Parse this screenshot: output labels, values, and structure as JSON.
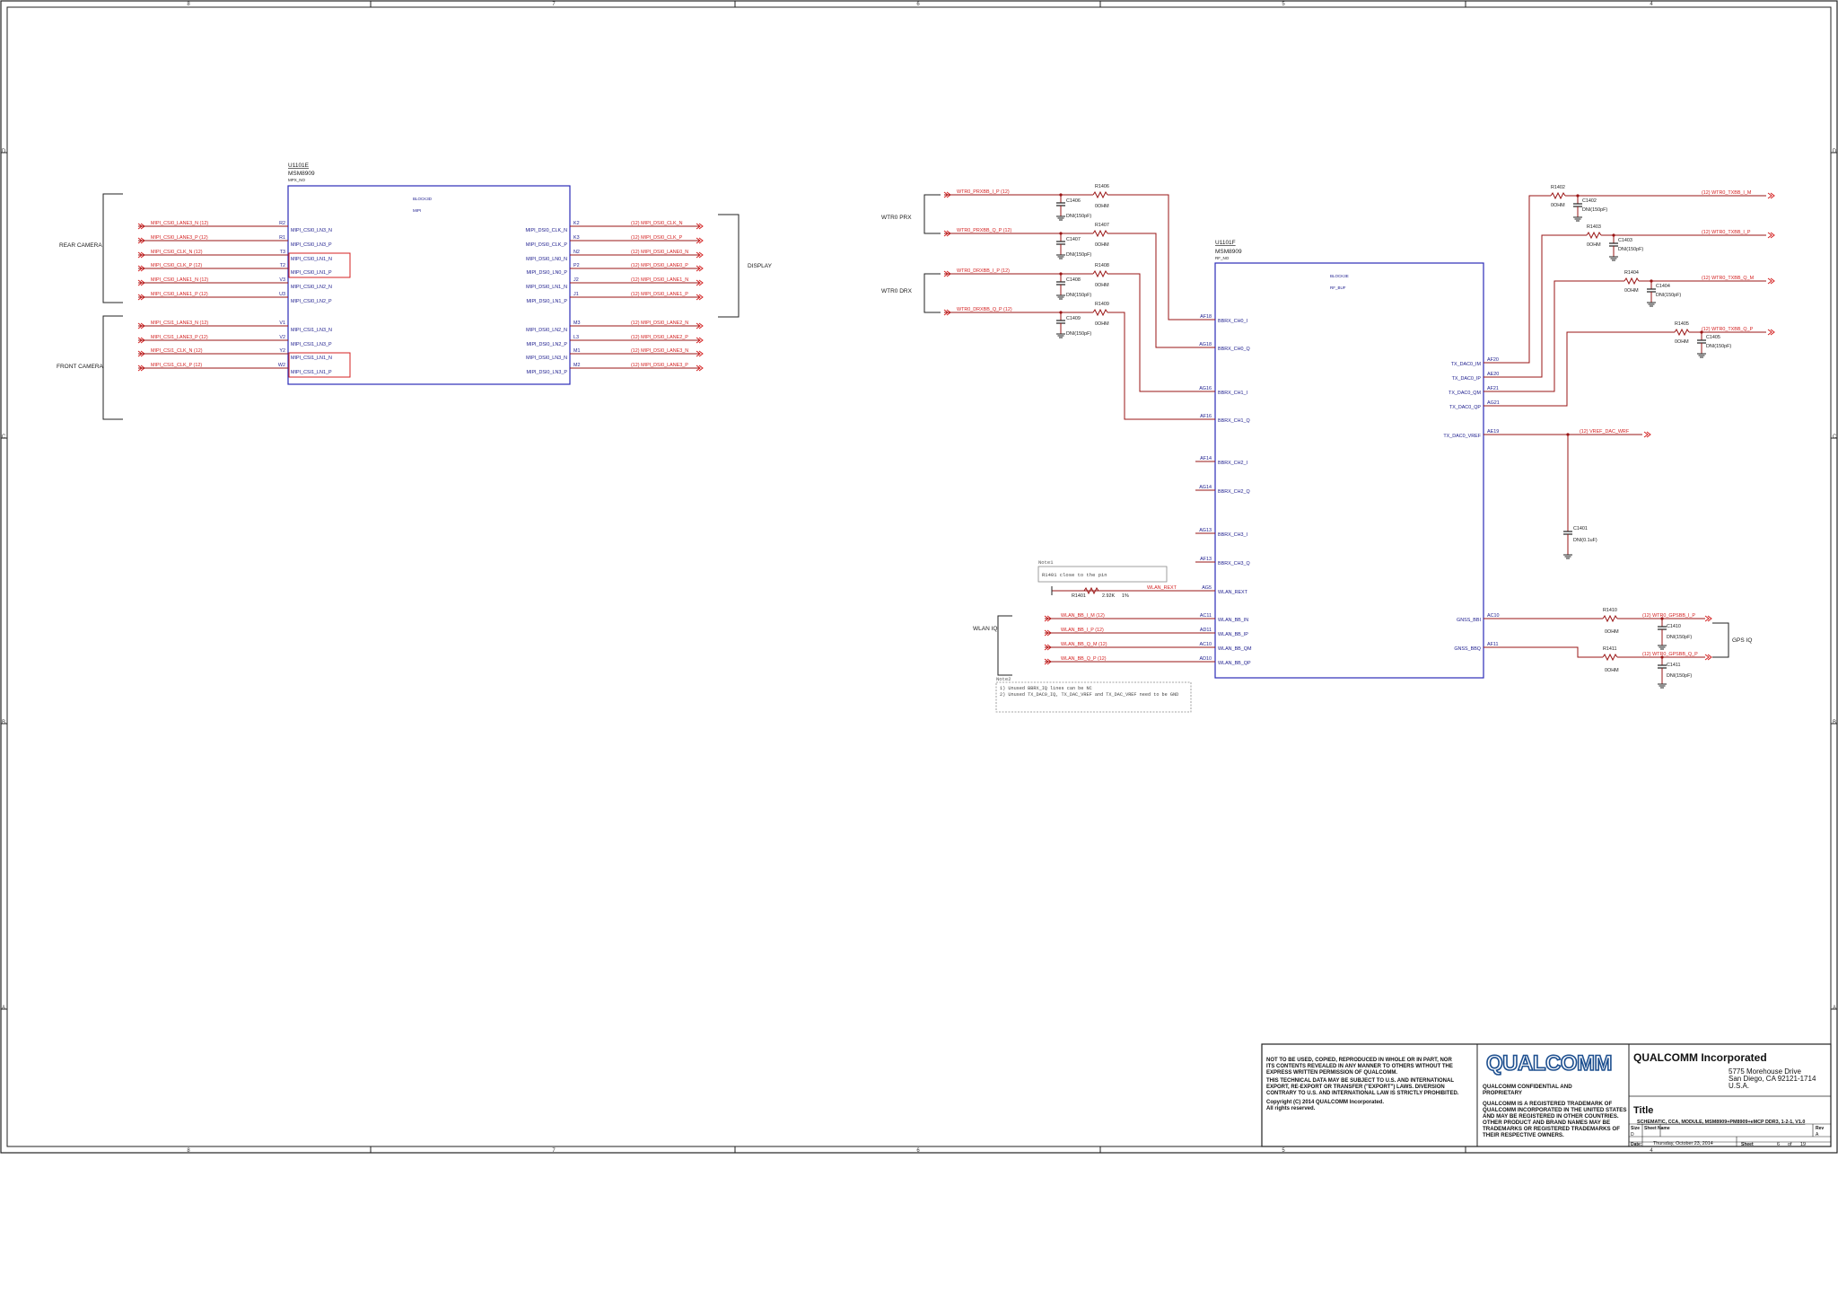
{
  "colors": {
    "frame": "#222222",
    "wire": "#9a1515",
    "net_label": "#d42020",
    "part_outline": "#2b2bb8",
    "pin_text": "#1a1a8c",
    "ref_text": "#1a1a1a",
    "note_border": "#888888",
    "logo": "#1d4f8f"
  },
  "frame": {
    "col_markers": [
      "8",
      "7",
      "6",
      "5",
      "4",
      "3",
      "2",
      "1"
    ],
    "row_markers": [
      "D",
      "C",
      "B",
      "A"
    ]
  },
  "mipi": {
    "ref": "U1101E",
    "part": "MSM8909",
    "sub": "MPX_NO",
    "block_title": "BLOCK3D",
    "block_sub": "MIPI",
    "rear_label": "REAR CAMERA",
    "front_label": "FRONT CAMERA",
    "display_label": "DISPLAY",
    "left_nets": [
      "MIPI_CSI0_LANE3_N  (12)",
      "MIPI_CSI0_LANE3_P  (12)",
      "MIPI_CSI0_CLK_N  (12)",
      "MIPI_CSI0_CLK_P  (12)",
      "MIPI_CSI0_LANE1_N  (12)",
      "MIPI_CSI0_LANE1_P  (12)",
      "MIPI_CSI1_LANE3_N  (12)",
      "MIPI_CSI1_LANE3_P  (12)",
      "MIPI_CSI1_CLK_N  (12)",
      "MIPI_CSI1_CLK_P  (12)"
    ],
    "left_pins": [
      "R2",
      "R1",
      "T3",
      "T2",
      "V3",
      "U3",
      "V1",
      "V2",
      "Y2",
      "W2"
    ],
    "left_signals": [
      "MIPI_CSI0_LN3_N",
      "MIPI_CSI0_LN3_P",
      "MIPI_CSI0_LN1_N",
      "MIPI_CSI0_LN1_P",
      "MIPI_CSI0_LN2_N",
      "MIPI_CSI0_LN2_P",
      "MIPI_CSI1_LN3_N",
      "MIPI_CSI1_LN3_P",
      "MIPI_CSI1_LN1_N",
      "MIPI_CSI1_LN1_P"
    ],
    "right_signals": [
      "MIPI_DSI0_CLK_N",
      "MIPI_DSI0_CLK_P",
      "MIPI_DSI0_LN0_N",
      "MIPI_DSI0_LN0_P",
      "MIPI_DSI0_LN1_N",
      "MIPI_DSI0_LN1_P",
      "MIPI_DSI0_LN2_N",
      "MIPI_DSI0_LN2_P",
      "MIPI_DSI0_LN3_N",
      "MIPI_DSI0_LN3_P"
    ],
    "right_pins": [
      "K2",
      "K3",
      "N2",
      "P2",
      "J2",
      "J1",
      "M3",
      "L3",
      "M1",
      "M2"
    ],
    "right_nets": [
      "(12)  MIPI_DSI0_CLK_N",
      "(12)  MIPI_DSI0_CLK_P",
      "(12)  MIPI_DSI0_LANE0_N",
      "(12)  MIPI_DSI0_LANE0_P",
      "(12)  MIPI_DSI0_LANE1_N",
      "(12)  MIPI_DSI0_LANE1_P",
      "(12)  MIPI_DSI0_LANE2_N",
      "(12)  MIPI_DSI0_LANE2_P",
      "(12)  MIPI_DSI0_LANE3_N",
      "(12)  MIPI_DSI0_LANE3_P"
    ]
  },
  "rf": {
    "ref": "U1101F",
    "part": "MSM8909",
    "sub": "RF_NO",
    "block_title": "BLOCK3E",
    "block_sub": "RF_BUF",
    "prx_label": "WTR0 PRX",
    "drx_label": "WTR0 DRX",
    "wlan_label": "WLAN IQ",
    "gps_label": "GPS IQ",
    "rx_nets": [
      "WTR0_PRXBB_I_P  (12)",
      "WTR0_PRXBB_Q_P  (12)",
      "WTR0_DRXBB_I_P  (12)",
      "WTR0_DRXBB_Q_P  (12)"
    ],
    "rx_res": [
      "R1406",
      "R1407",
      "R1408",
      "R1409"
    ],
    "rx_res_val": "0OHM",
    "rx_caps": [
      "C1406",
      "C1407",
      "C1408",
      "C1409"
    ],
    "dnp_150pf": "DNI(150pF)",
    "left_pins": [
      "AF18",
      "AG18",
      "AG16",
      "AF16",
      "AF14",
      "AG14",
      "AG13",
      "AF13",
      "AG5",
      "AC11",
      "AD11",
      "AC10",
      "AD10"
    ],
    "left_signals": [
      "BBRX_CH0_I",
      "BBRX_CH0_Q",
      "BBRX_CH1_I",
      "BBRX_CH1_Q",
      "BBRX_CH2_I",
      "BBRX_CH2_Q",
      "BBRX_CH3_I",
      "BBRX_CH3_Q",
      "WLAN_REXT",
      "WLAN_BB_IN",
      "WLAN_BB_IP",
      "WLAN_BB_QM",
      "WLAN_BB_QP"
    ],
    "right_signals": [
      "TX_DAC0_IM",
      "TX_DAC0_IP",
      "TX_DAC0_QM",
      "TX_DAC0_QP",
      "TX_DAC0_VREF",
      "GNSS_BBI",
      "GNSS_BBQ"
    ],
    "right_pins": [
      "AF20",
      "AE20",
      "AF21",
      "AG21",
      "AE19",
      "AC10",
      "AF11"
    ],
    "tx_nets": [
      "(12)  WTR0_TXBB_I_M",
      "(12)  WTR0_TXBB_I_P",
      "(12)  WTR0_TXBB_Q_M",
      "(12)  WTR0_TXBB_Q_P"
    ],
    "tx_res": [
      "R1402",
      "R1403",
      "R1404",
      "R1405"
    ],
    "tx_caps": [
      "C1402",
      "C1403",
      "C1404",
      "C1405"
    ],
    "vref_net": "(12)  VREF_DAC_WRF",
    "vref_cap": "C1401",
    "vref_cap_val": "DNI(0.1uF)",
    "gps_nets": [
      "(12)  WTR0_GPSBB_I_P",
      "(12)  WTR0_GPSBB_Q_P"
    ],
    "gps_res": [
      "R1410",
      "R1411"
    ],
    "gps_caps": [
      "C1410",
      "C1411"
    ],
    "wlan_nets": [
      "WLAN_BB_I_M  (12)",
      "WLAN_BB_I_P  (12)",
      "WLAN_BB_Q_M  (12)",
      "WLAN_BB_Q_P  (12)"
    ],
    "rext_net": "WLAN_REXT",
    "rext_res": "R1401",
    "rext_val": "2.92K",
    "rext_tol": "1%",
    "note1_title": "Note1",
    "note1_text": "R1401 close to the pin",
    "note2_title": "Note2",
    "note2_lines": [
      "1) Unused BBRX_IQ lines can be NC",
      "2) Unused TX_DAC0_IQ, TX_DAC_VREF and TX_DAC_VREF need to be GND"
    ]
  },
  "title_block": {
    "disclaimer_1": [
      "NOT TO BE USED, COPIED, REPRODUCED IN WHOLE OR IN PART, NOR",
      "ITS CONTENTS REVEALED IN ANY MANNER TO OTHERS WITHOUT THE",
      "EXPRESS WRITTEN PERMISSION OF QUALCOMM."
    ],
    "disclaimer_2": [
      "THIS TECHNICAL DATA MAY BE SUBJECT TO U.S. AND INTERNATIONAL",
      "EXPORT, RE-EXPORT OR TRANSFER (\"EXPORT\") LAWS.  DIVERSION",
      "CONTRARY TO U.S. AND INTERNATIONAL LAW IS STRICTLY PROHIBITED."
    ],
    "copyright": "Copyright (C) 2014  QUALCOMM Incorporated.",
    "rights": "All rights reserved.",
    "logo": "QUALCOMM",
    "confidential": [
      "QUALCOMM CONFIDENTIAL AND",
      "PROPRIETARY"
    ],
    "trademark": [
      "QUALCOMM IS A REGISTERED TRADEMARK OF",
      "QUALCOMM INCORPORATED IN THE UNITED STATES",
      "AND MAY BE REGISTERED IN OTHER COUNTRIES.",
      "OTHER PRODUCT AND BRAND NAMES MAY BE",
      "TRADEMARKS OR REGISTERED TRADEMARKS OF",
      "THEIR RESPECTIVE OWNERS."
    ],
    "company": "QUALCOMM  Incorporated",
    "address": [
      "5775 Morehouse Drive",
      "San Diego, CA 92121-1714",
      "U.S.A."
    ],
    "title_label": "Title",
    "title_value": "SCHEMATIC, CCA, MODULE, MSM8909+PM8909+eMCP DDR3, 1-2-1, V1.0",
    "size_label": "Size",
    "size_value": "D",
    "sheet_name_label": "Sheet Name",
    "rev_label": "Rev",
    "rev_value": "A",
    "date_label": "Date:",
    "date_value": "Thursday, October 23, 2014",
    "sheet_label": "Sheet",
    "sheet_no": "6",
    "of_label": "of",
    "sheet_total": "19"
  }
}
